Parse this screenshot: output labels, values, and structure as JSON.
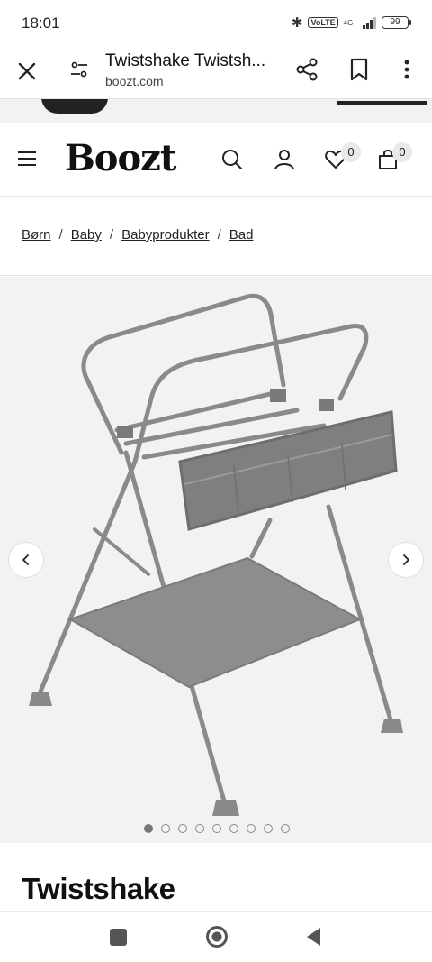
{
  "status_bar": {
    "time": "18:01",
    "volte": "VoLTE",
    "network": "4G+",
    "battery": "99"
  },
  "browser": {
    "title": "Twistshake Twistsh...",
    "url": "boozt.com"
  },
  "header": {
    "logo": "Boozt",
    "wishlist_count": "0",
    "cart_count": "0"
  },
  "breadcrumb": {
    "items": [
      "Børn",
      "Baby",
      "Babyprodukter",
      "Bad"
    ],
    "separator": "/"
  },
  "gallery": {
    "image_count": 9,
    "active_index": 0
  },
  "product": {
    "brand": "Twistshake"
  },
  "icons": {
    "close": "close-icon",
    "tune": "tune-icon",
    "share": "share-icon",
    "bookmark": "bookmark-icon",
    "more": "more-vert-icon",
    "menu": "hamburger-icon",
    "search": "search-icon",
    "account": "account-icon",
    "wishlist": "heart-icon",
    "cart": "bag-icon",
    "prev": "chevron-left-icon",
    "next": "chevron-right-icon"
  },
  "colors": {
    "gallery_bg": "#f2f2f2",
    "text": "#111111",
    "frame": "#8a8a8a"
  }
}
